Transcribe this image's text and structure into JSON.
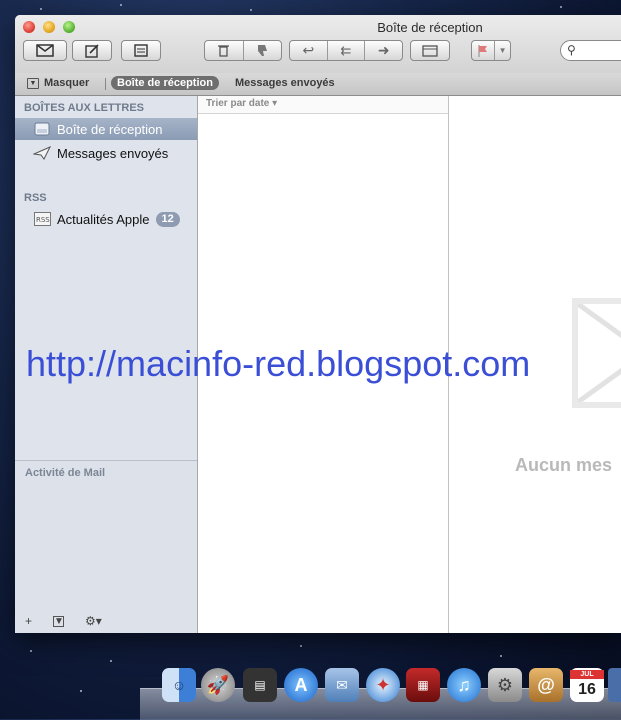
{
  "window": {
    "title": "Boîte de réception"
  },
  "favorites_bar": {
    "hide_label": "Masquer",
    "inbox_label": "Boîte de réception",
    "sent_label": "Messages envoyés"
  },
  "sidebar": {
    "mailboxes_header": "BOÎTES AUX LETTRES",
    "items": [
      {
        "label": "Boîte de réception",
        "icon": "inbox-tray-icon",
        "selected": true
      },
      {
        "label": "Messages envoyés",
        "icon": "paper-plane-icon",
        "selected": false
      }
    ],
    "rss_header": "RSS",
    "rss_items": [
      {
        "label": "Actualités Apple",
        "icon": "rss-feed-icon",
        "badge": "12"
      }
    ],
    "activity_label": "Activité de Mail"
  },
  "message_list": {
    "sort_label": "Trier par date ▾"
  },
  "preview": {
    "empty_text": "Aucun mes"
  },
  "watermark": "http://macinfo-red.blogspot.com",
  "dock": {
    "calendar_month": "JUL",
    "calendar_day": "16"
  },
  "colors": {
    "accent_selection": "#8a9bb4",
    "watermark": "#3a4fd6",
    "badge": "#8e9bb0"
  }
}
